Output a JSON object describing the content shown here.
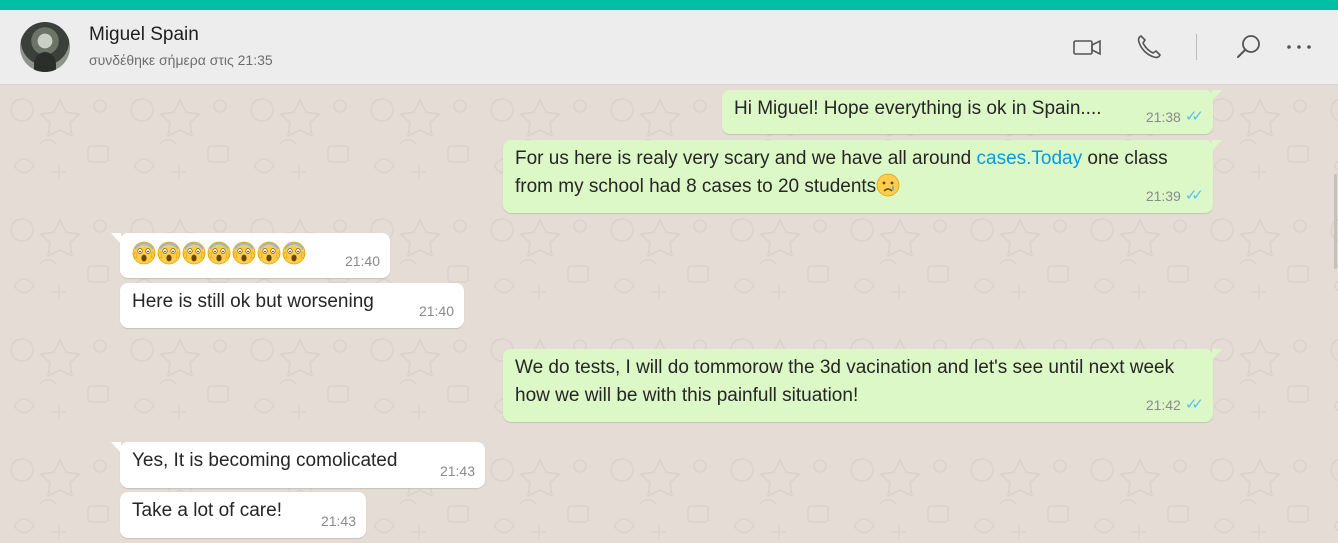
{
  "header": {
    "contact_name": "Miguel Spain",
    "status": "συνδέθηκε σήμερα στις 21:35",
    "icons": [
      "video-call-icon",
      "voice-call-icon",
      "search-icon",
      "more-options-icon"
    ]
  },
  "colors": {
    "accent_strip": "#00bfa5",
    "outgoing_bubble": "#dcf8c6",
    "incoming_bubble": "#ffffff",
    "read_ticks": "#4fc3f7",
    "link": "#039be5"
  },
  "messages": [
    {
      "direction": "outgoing",
      "text": "Hi Miguel! Hope everything is ok in Spain....",
      "time": "21:38",
      "read": true
    },
    {
      "direction": "outgoing",
      "text_before_link": "For us  here is realy very scary and we have all around ",
      "link_text": "cases.Today",
      "text_after_link": " one class from my school had 8 cases to 20 students",
      "emoji": "crying-face",
      "time": "21:39",
      "read": true
    },
    {
      "direction": "incoming",
      "emoji": "face-screaming-in-fear",
      "emoji_count": 7,
      "time": "21:40"
    },
    {
      "direction": "incoming",
      "text": "Here is still ok but worsening",
      "time": "21:40"
    },
    {
      "direction": "outgoing",
      "text": "We do tests, I will do  tommorow the 3d vacination and let's see until next week how we will be with this painfull situation!",
      "time": "21:42",
      "read": true
    },
    {
      "direction": "incoming",
      "text": "Yes, It is becoming comolicated",
      "time": "21:43"
    },
    {
      "direction": "incoming",
      "text": "Take a lot of care!",
      "time": "21:43"
    }
  ]
}
